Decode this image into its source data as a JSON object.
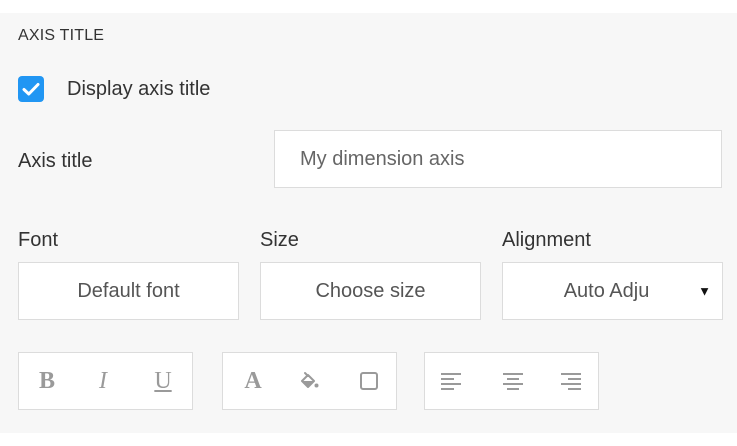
{
  "section": {
    "title": "AXIS TITLE"
  },
  "display_axis_title": {
    "label": "Display axis title",
    "checked": true,
    "color": "#2196f3"
  },
  "axis_title": {
    "label": "Axis title",
    "placeholder": "My dimension axis",
    "value": ""
  },
  "font": {
    "label": "Font",
    "value": "Default font"
  },
  "size": {
    "label": "Size",
    "value": "Choose size"
  },
  "alignment": {
    "label": "Alignment",
    "value": "Auto Adju",
    "arrow": "▼"
  },
  "toolbar": {
    "bold": "B",
    "italic": "I",
    "underline": "U",
    "font_color": "A",
    "icons": {
      "fill": "paint-bucket-icon",
      "border": "border-box-icon",
      "align_left": "align-left-icon",
      "align_center": "align-center-icon",
      "align_right": "align-right-icon"
    },
    "icon_color": "#9a9a9a"
  }
}
